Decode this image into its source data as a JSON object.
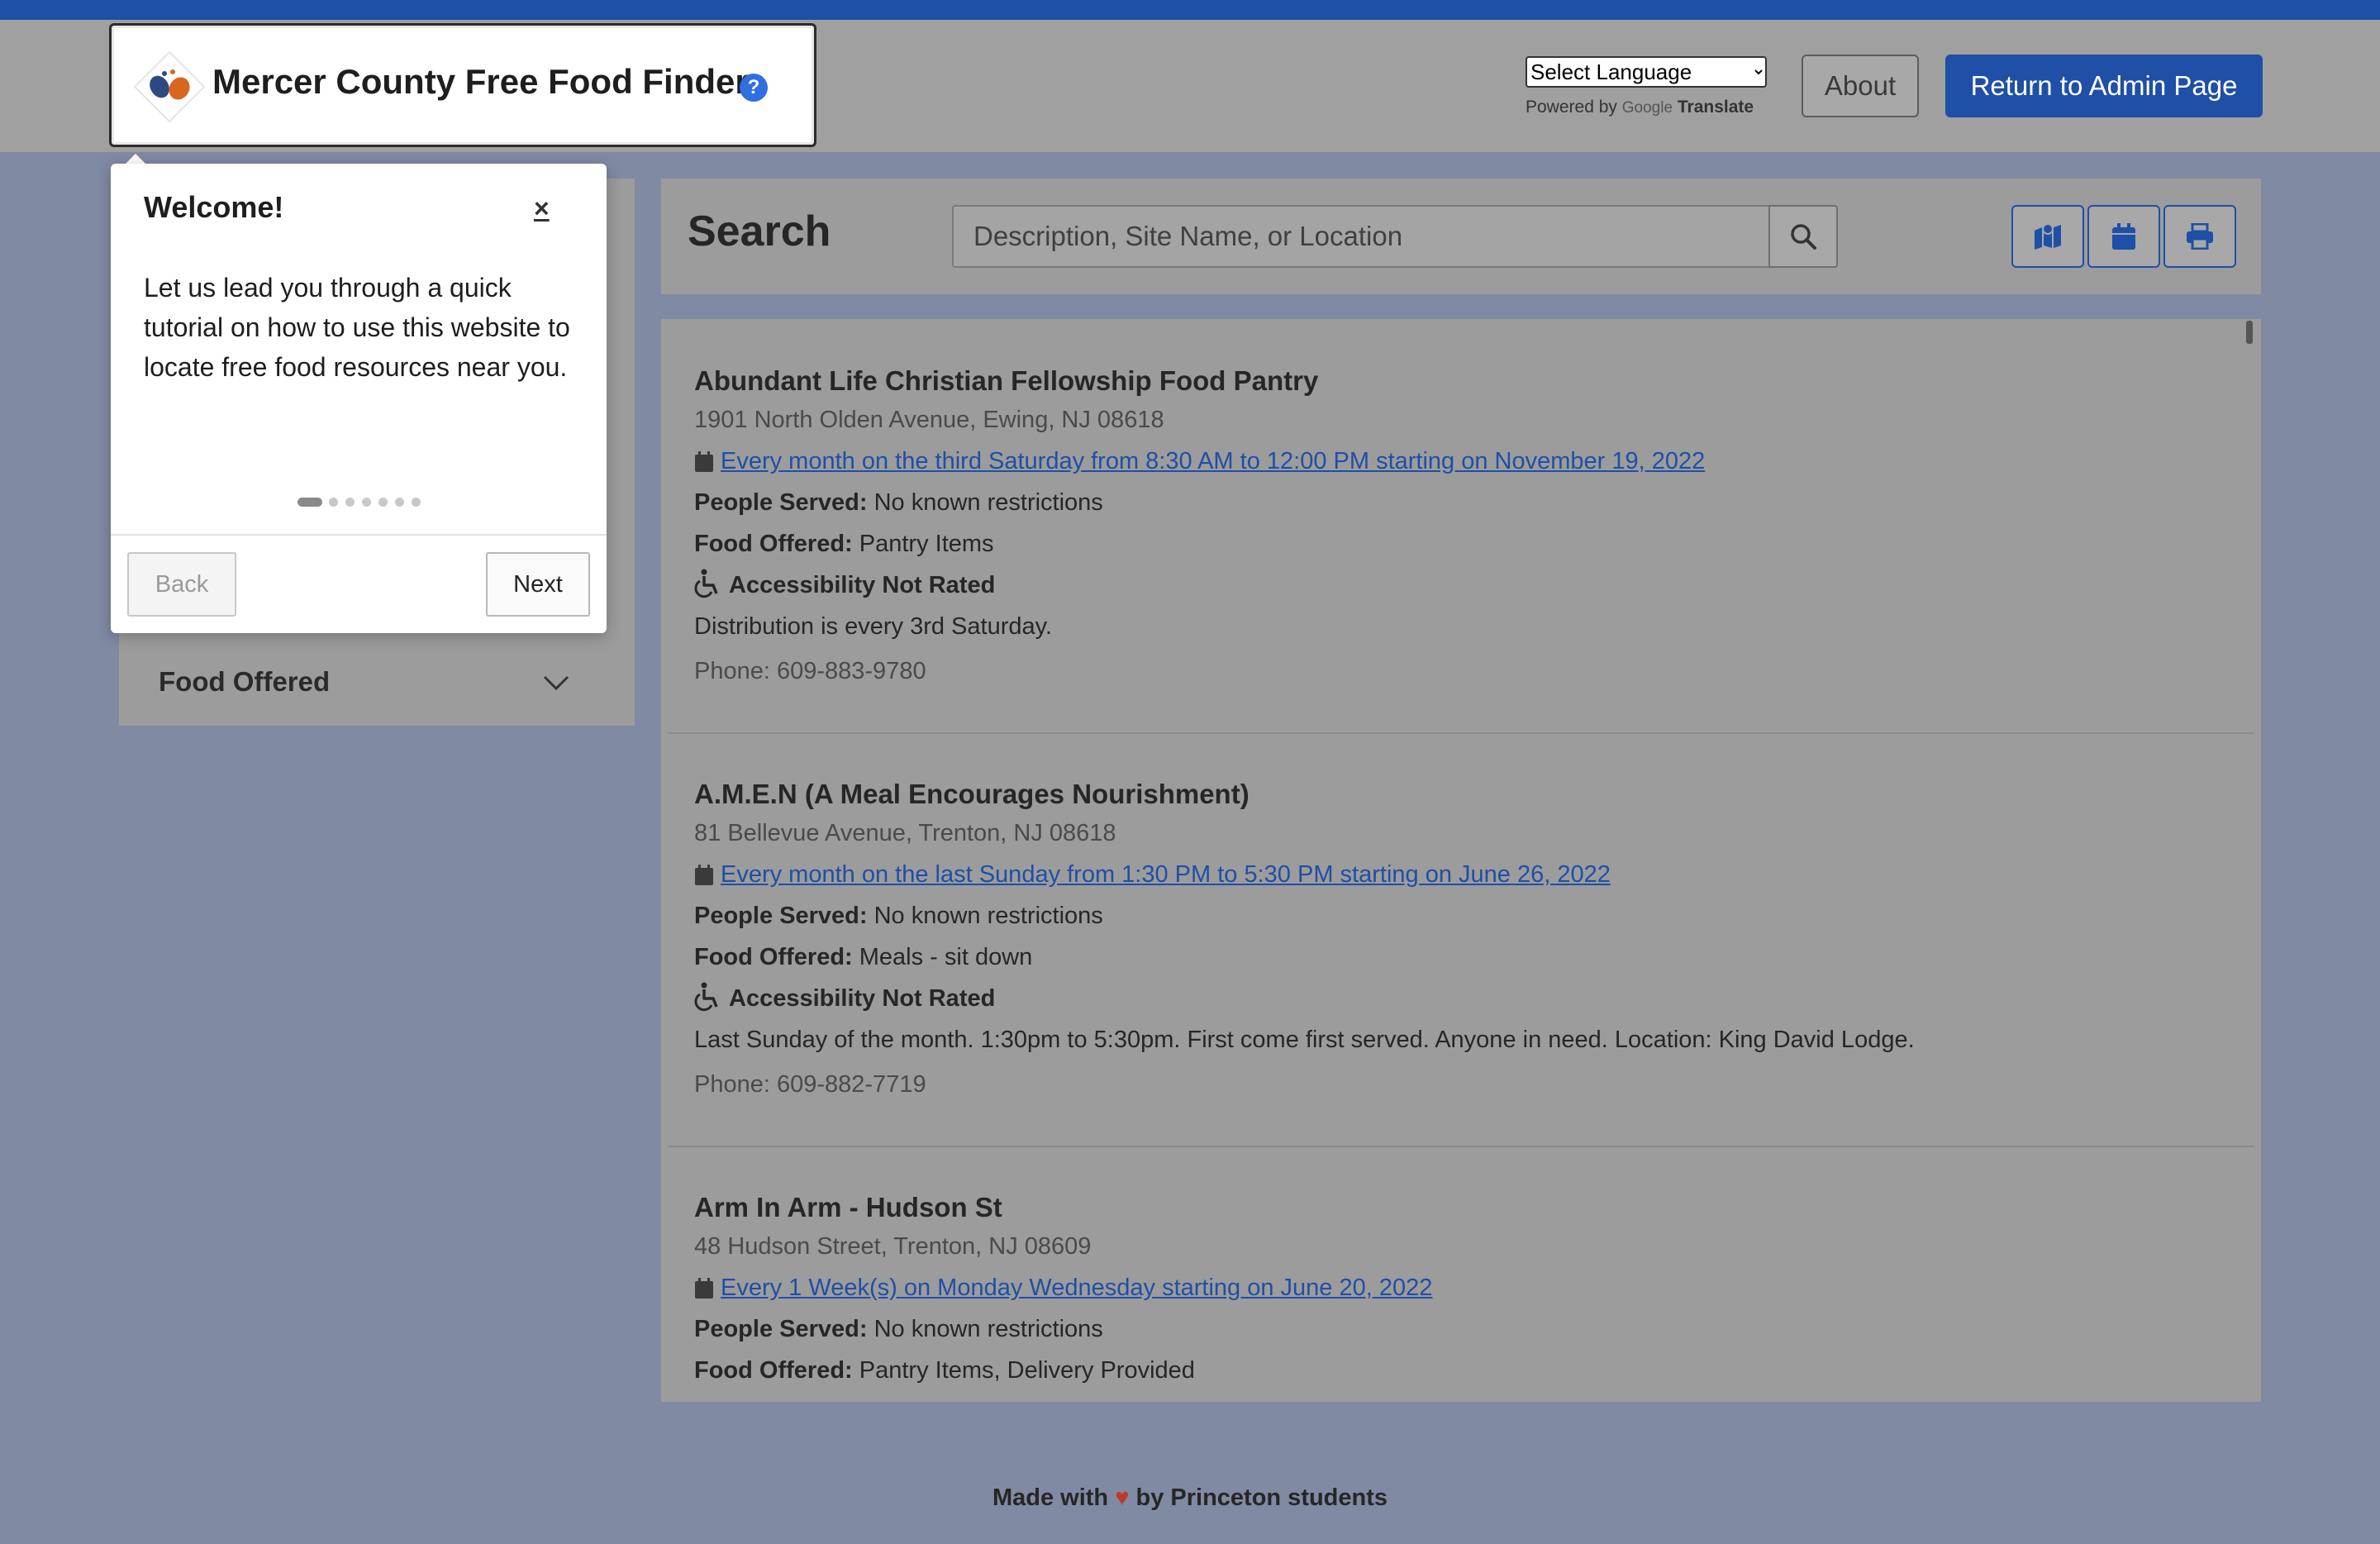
{
  "app": {
    "title": "Mercer County Free Food Finder",
    "help_glyph": "?"
  },
  "header": {
    "language_select": "Select Language",
    "powered_by": "Powered by",
    "google": "Google",
    "translate": "Translate",
    "about_label": "About",
    "admin_label": "Return to Admin Page"
  },
  "tour": {
    "title": "Welcome!",
    "close_glyph": "×",
    "body": "Let us lead you through a quick tutorial on how to use this website to locate free food resources near you.",
    "step": 1,
    "step_count": 7,
    "back_label": "Back",
    "next_label": "Next"
  },
  "sidebar": {
    "filter_food_offered": "Food Offered"
  },
  "search": {
    "title": "Search",
    "placeholder": "Description, Site Name, or Location",
    "icon_buttons": [
      "map-icon",
      "calendar-icon",
      "print-icon"
    ]
  },
  "labels": {
    "people_served": "People Served:",
    "food_offered": "Food Offered:",
    "accessibility": "Accessibility Not Rated"
  },
  "results": [
    {
      "name": "Abundant Life Christian Fellowship Food Pantry",
      "address": "1901 North Olden Avenue, Ewing, NJ 08618",
      "schedule": "Every month on the third Saturday from 8:30 AM to 12:00 PM starting on November 19, 2022",
      "people_served": "No known restrictions",
      "food_offered": "Pantry Items",
      "description": "Distribution is every 3rd Saturday.",
      "phone": "Phone: 609-883-9780"
    },
    {
      "name": "A.M.E.N (A Meal Encourages Nourishment)",
      "address": "81 Bellevue Avenue, Trenton, NJ 08618",
      "schedule": "Every month on the last Sunday from 1:30 PM to 5:30 PM starting on June 26, 2022",
      "people_served": "No known restrictions",
      "food_offered": "Meals - sit down",
      "description": "Last Sunday of the month. 1:30pm to 5:30pm. First come first served. Anyone in need. Location: King David Lodge.",
      "phone": "Phone: 609-882-7719"
    },
    {
      "name": "Arm In Arm - Hudson St",
      "address": "48 Hudson Street, Trenton, NJ 08609",
      "schedule": "Every 1 Week(s) on Monday Wednesday starting on June 20, 2022",
      "people_served": "No known restrictions",
      "food_offered": "Pantry Items, Delivery Provided"
    }
  ],
  "footer": {
    "made_with": "Made with",
    "heart": "♥",
    "by": "by Princeton students"
  },
  "colors": {
    "brand_blue": "#1f4fa6",
    "overlay": "#818aa3",
    "help_blue": "#2f6fe0"
  }
}
